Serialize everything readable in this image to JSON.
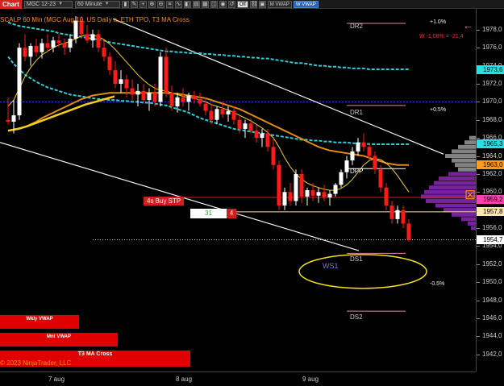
{
  "toolbar": {
    "tab_label": "Chart",
    "instrument": "MGC 12-23",
    "interval": "60 Minute",
    "off_label": "Off",
    "m_vwap_label": "M VWAP",
    "w_vwap_label": "W VWAP"
  },
  "chart": {
    "info_line": "SCALP 60 Min (MGC Aug 10, US Daily a,  ETH TPO, T3 MA Cross",
    "wlabel": "W -1,08% = -21,4",
    "buy_stop_label": "4s Buy STP",
    "order_qty": "31",
    "order_count": "4",
    "ws1_label": "WS1",
    "copyright": "© 2023 NinjaTrader, LLC",
    "pivots": {
      "dr2": "DR2",
      "dr1": "DR1",
      "dpp": "DPP",
      "ds1": "DS1",
      "ds2": "DS2"
    },
    "percent_labels": {
      "plus_1": "+1.0%",
      "plus_05": "+0.5%",
      "minus_05": "-0.5%"
    },
    "indicator_bars": [
      {
        "label": "Wkly VWAP",
        "width_frac": 0.157
      },
      {
        "label": "Mnt VWAP",
        "width_frac": 0.234
      },
      {
        "label": "T3 MA Cross",
        "width_frac": 0.377
      }
    ],
    "price_ticks": [
      "1978,0",
      "1976,0",
      "1974,0",
      "1972,0",
      "1970,0",
      "1968,0",
      "1966,0",
      "1964,0",
      "1962,0",
      "1960,0",
      "1958,0",
      "1956,0",
      "1954,0",
      "1952,0",
      "1950,0",
      "1948,0",
      "1946,0",
      "1944,0",
      "1942,0"
    ],
    "price_badges": [
      {
        "text": "1973,6",
        "value": 1973.6,
        "color": "#27e0e6"
      },
      {
        "text": "1965,3",
        "value": 1965.3,
        "color": "#27e0e6"
      },
      {
        "text": "1963,0",
        "value": 1963.0,
        "color": "#ff9a1a"
      },
      {
        "text": "1959,2",
        "value": 1959.2,
        "color": "#ff3fb0"
      },
      {
        "text": "1957,8",
        "value": 1957.8,
        "color": "#ffe7a8"
      },
      {
        "text": "1954,7",
        "value": 1954.7,
        "color": "#ffffff"
      }
    ],
    "date_labels": [
      "7 aug",
      "8 aug",
      "9 aug"
    ],
    "colors": {
      "bull": "#ffffff",
      "bear": "#ff1a1a",
      "vwap": "#2ad0d8",
      "ma_yellow": "#f2d01a",
      "ma_orange": "#e08a1a",
      "profile": "#8a2ab8"
    }
  },
  "chart_data": {
    "type": "candlestick",
    "title": "SCALP 60 Min (MGC Aug 10, US Daily a, ETH TPO, T3 MA Cross",
    "ylim": [
      1941,
      1979.5
    ],
    "y_unit": "price",
    "candles": [
      [
        1968.0,
        1970.5,
        1967.5,
        1967.8
      ],
      [
        1967.8,
        1970.2,
        1966.5,
        1968.5
      ],
      [
        1968.5,
        1976.5,
        1968.0,
        1976.0
      ],
      [
        1976.0,
        1977.5,
        1974.5,
        1975.0
      ],
      [
        1975.0,
        1976.5,
        1974.0,
        1976.2
      ],
      [
        1976.2,
        1977.0,
        1975.0,
        1975.5
      ],
      [
        1975.5,
        1977.0,
        1974.8,
        1976.5
      ],
      [
        1976.5,
        1977.5,
        1975.5,
        1976.0
      ],
      [
        1976.0,
        1977.2,
        1975.5,
        1976.8
      ],
      [
        1976.8,
        1977.5,
        1976.0,
        1976.5
      ],
      [
        1976.5,
        1977.0,
        1975.2,
        1976.0
      ],
      [
        1976.0,
        1977.5,
        1975.5,
        1977.0
      ],
      [
        1977.0,
        1979.5,
        1976.5,
        1979.0
      ],
      [
        1979.0,
        1979.5,
        1977.0,
        1977.5
      ],
      [
        1977.5,
        1978.5,
        1976.5,
        1976.8
      ],
      [
        1976.8,
        1978.0,
        1976.0,
        1977.5
      ],
      [
        1977.5,
        1978.0,
        1975.5,
        1976.0
      ],
      [
        1976.0,
        1977.0,
        1974.5,
        1975.0
      ],
      [
        1975.0,
        1975.5,
        1973.0,
        1973.5
      ],
      [
        1973.5,
        1974.5,
        1971.5,
        1972.0
      ],
      [
        1972.0,
        1973.5,
        1971.0,
        1972.5
      ],
      [
        1972.5,
        1973.0,
        1970.5,
        1971.5
      ],
      [
        1971.5,
        1972.5,
        1970.0,
        1970.8
      ],
      [
        1970.8,
        1972.0,
        1969.5,
        1971.2
      ],
      [
        1971.2,
        1972.0,
        1969.8,
        1970.2
      ],
      [
        1970.2,
        1971.5,
        1969.0,
        1971.0
      ],
      [
        1971.0,
        1972.0,
        1969.5,
        1970.0
      ],
      [
        1970.0,
        1975.5,
        1969.5,
        1975.0
      ],
      [
        1975.0,
        1976.0,
        1970.5,
        1971.0
      ],
      [
        1971.0,
        1971.8,
        1969.0,
        1969.5
      ],
      [
        1969.5,
        1971.0,
        1968.8,
        1970.5
      ],
      [
        1970.5,
        1971.5,
        1969.5,
        1970.0
      ],
      [
        1970.0,
        1971.0,
        1969.0,
        1970.7
      ],
      [
        1970.7,
        1971.2,
        1969.8,
        1970.3
      ],
      [
        1970.3,
        1971.0,
        1969.5,
        1969.8
      ],
      [
        1969.8,
        1970.5,
        1968.5,
        1969.0
      ],
      [
        1969.0,
        1969.8,
        1967.5,
        1968.0
      ],
      [
        1968.0,
        1969.5,
        1967.5,
        1969.2
      ],
      [
        1969.2,
        1970.0,
        1968.2,
        1968.6
      ],
      [
        1968.6,
        1969.5,
        1967.8,
        1969.0
      ],
      [
        1969.0,
        1969.5,
        1967.5,
        1968.0
      ],
      [
        1968.0,
        1968.5,
        1966.5,
        1967.0
      ],
      [
        1967.0,
        1968.0,
        1966.0,
        1967.6
      ],
      [
        1967.6,
        1968.2,
        1966.5,
        1966.8
      ],
      [
        1966.8,
        1967.5,
        1965.5,
        1966.0
      ],
      [
        1966.0,
        1967.0,
        1965.0,
        1966.5
      ],
      [
        1966.5,
        1967.0,
        1964.5,
        1965.0
      ],
      [
        1965.0,
        1966.0,
        1962.5,
        1963.0
      ],
      [
        1963.0,
        1963.5,
        1958.0,
        1958.5
      ],
      [
        1958.5,
        1960.5,
        1958.0,
        1960.0
      ],
      [
        1960.0,
        1961.0,
        1958.5,
        1959.0
      ],
      [
        1959.0,
        1962.5,
        1958.5,
        1962.0
      ],
      [
        1962.0,
        1962.5,
        1958.8,
        1959.5
      ],
      [
        1959.5,
        1960.5,
        1958.5,
        1960.2
      ],
      [
        1960.2,
        1961.0,
        1959.0,
        1959.6
      ],
      [
        1959.6,
        1960.5,
        1958.8,
        1960.0
      ],
      [
        1960.0,
        1960.8,
        1959.0,
        1959.4
      ],
      [
        1959.4,
        1960.2,
        1958.5,
        1959.8
      ],
      [
        1959.8,
        1961.0,
        1959.5,
        1960.8
      ],
      [
        1960.8,
        1962.5,
        1960.5,
        1962.2
      ],
      [
        1962.2,
        1964.0,
        1961.5,
        1963.5
      ],
      [
        1963.5,
        1965.0,
        1963.0,
        1964.5
      ],
      [
        1964.5,
        1966.0,
        1964.0,
        1965.5
      ],
      [
        1965.5,
        1966.5,
        1964.5,
        1965.0
      ],
      [
        1965.0,
        1965.5,
        1963.5,
        1964.0
      ],
      [
        1964.0,
        1964.5,
        1962.0,
        1962.5
      ],
      [
        1962.5,
        1963.0,
        1960.0,
        1960.5
      ],
      [
        1960.5,
        1961.0,
        1958.0,
        1958.5
      ],
      [
        1958.5,
        1959.0,
        1956.5,
        1957.0
      ],
      [
        1957.0,
        1958.5,
        1956.5,
        1958.0
      ],
      [
        1958.0,
        1958.5,
        1956.0,
        1956.5
      ],
      [
        1956.5,
        1957.0,
        1954.5,
        1954.7
      ]
    ],
    "series": [
      {
        "name": "Wkly VWAP",
        "values": [
          1978.8,
          1978.6,
          1978.4,
          1978.3,
          1978.2,
          1978.1,
          1978.0,
          1977.9,
          1977.8,
          1977.6,
          1977.5,
          1977.4,
          1977.3,
          1977.2,
          1977.1,
          1977.0,
          1976.9,
          1976.8,
          1976.6,
          1976.5,
          1976.4,
          1976.3,
          1976.2,
          1976.1,
          1976.0,
          1975.9,
          1975.8,
          1975.7,
          1975.6,
          1975.6,
          1975.5,
          1975.5,
          1975.4,
          1975.4,
          1975.4,
          1975.3,
          1975.3,
          1975.2,
          1975.2,
          1975.1,
          1975.1,
          1975.0,
          1975.0,
          1974.9,
          1974.9,
          1974.8,
          1974.8,
          1974.7,
          1974.6,
          1974.5,
          1974.4,
          1974.3,
          1974.3,
          1974.2,
          1974.1,
          1974.0,
          1974.0,
          1973.9,
          1973.9,
          1973.8,
          1973.8,
          1973.7,
          1973.7,
          1973.7,
          1973.6,
          1973.6,
          1973.6,
          1973.6,
          1973.6,
          1973.6,
          1973.6,
          1973.6
        ]
      },
      {
        "name": "Mnt VWAP",
        "values": [
          1975.0,
          1974.2,
          1973.6,
          1973.0,
          1972.6,
          1972.2,
          1971.9,
          1971.6,
          1971.4,
          1971.2,
          1971.0,
          1970.8,
          1970.7,
          1970.6,
          1970.5,
          1970.4,
          1970.3,
          1970.3,
          1970.2,
          1970.2,
          1970.1,
          1970.1,
          1970.0,
          1970.0,
          1969.9,
          1969.9,
          1969.8,
          1969.7,
          1969.6,
          1969.4,
          1969.2,
          1969.0,
          1968.8,
          1968.5,
          1968.2,
          1968.0,
          1967.8,
          1967.6,
          1967.4,
          1967.2,
          1967.0,
          1966.9,
          1966.8,
          1966.7,
          1966.6,
          1966.5,
          1966.4,
          1966.3,
          1966.2,
          1966.1,
          1966.0,
          1965.9,
          1965.8,
          1965.8,
          1965.7,
          1965.7,
          1965.6,
          1965.6,
          1965.5,
          1965.5,
          1965.5,
          1965.4,
          1965.4,
          1965.4,
          1965.3,
          1965.3,
          1965.3,
          1965.3,
          1965.3,
          1965.3,
          1965.3,
          1965.3
        ]
      },
      {
        "name": "T3 MA fast",
        "values": [
          1969.5,
          1970.2,
          1971.5,
          1972.8,
          1973.8,
          1974.6,
          1975.2,
          1975.6,
          1976.0,
          1976.3,
          1976.5,
          1976.7,
          1977.0,
          1977.3,
          1977.4,
          1977.4,
          1977.2,
          1976.9,
          1976.4,
          1975.8,
          1975.1,
          1974.4,
          1973.7,
          1973.0,
          1972.4,
          1971.9,
          1971.5,
          1971.3,
          1971.2,
          1971.0,
          1970.8,
          1970.6,
          1970.5,
          1970.4,
          1970.2,
          1970.0,
          1969.7,
          1969.5,
          1969.3,
          1969.1,
          1968.8,
          1968.5,
          1968.2,
          1967.9,
          1967.5,
          1967.1,
          1966.6,
          1966.0,
          1965.0,
          1963.8,
          1962.8,
          1962.0,
          1961.4,
          1961.0,
          1960.7,
          1960.5,
          1960.3,
          1960.2,
          1960.2,
          1960.4,
          1960.8,
          1961.4,
          1962.2,
          1963.0,
          1963.5,
          1963.7,
          1963.6,
          1963.2,
          1962.6,
          1961.8,
          1960.9,
          1960.0
        ]
      },
      {
        "name": "T3 MA slow",
        "values": [
          1966.8,
          1966.9,
          1967.0,
          1967.2,
          1967.5,
          1967.8,
          1968.2,
          1968.5,
          1968.8,
          1969.1,
          1969.4,
          1969.7,
          1970.0,
          1970.3,
          1970.5,
          1970.7,
          1970.8,
          1970.9,
          1971.0,
          1971.0,
          1971.0,
          1971.0,
          1971.0,
          1971.0,
          1971.0,
          1971.0,
          1971.0,
          1971.0,
          1971.0,
          1970.9,
          1970.9,
          1970.8,
          1970.7,
          1970.6,
          1970.5,
          1970.4,
          1970.2,
          1970.0,
          1969.8,
          1969.6,
          1969.4,
          1969.2,
          1968.9,
          1968.6,
          1968.3,
          1968.0,
          1967.7,
          1967.4,
          1967.1,
          1966.8,
          1966.5,
          1966.2,
          1965.9,
          1965.6,
          1965.3,
          1965.0,
          1964.8,
          1964.6,
          1964.5,
          1964.4,
          1964.3,
          1964.2,
          1964.1,
          1964.0,
          1963.8,
          1963.6,
          1963.4,
          1963.2,
          1963.1,
          1963.0,
          1963.0,
          1963.0
        ]
      }
    ],
    "levels": [
      {
        "name": "DR2",
        "value": 1978.7
      },
      {
        "name": "DR1",
        "value": 1969.6
      },
      {
        "name": "DPP",
        "value": 1962.6
      },
      {
        "name": "DS1",
        "value": 1953.2
      },
      {
        "name": "DS2",
        "value": 1946.8
      },
      {
        "name": "Buy STP",
        "value": 1959.4
      },
      {
        "name": "Last",
        "value": 1954.7
      }
    ]
  }
}
